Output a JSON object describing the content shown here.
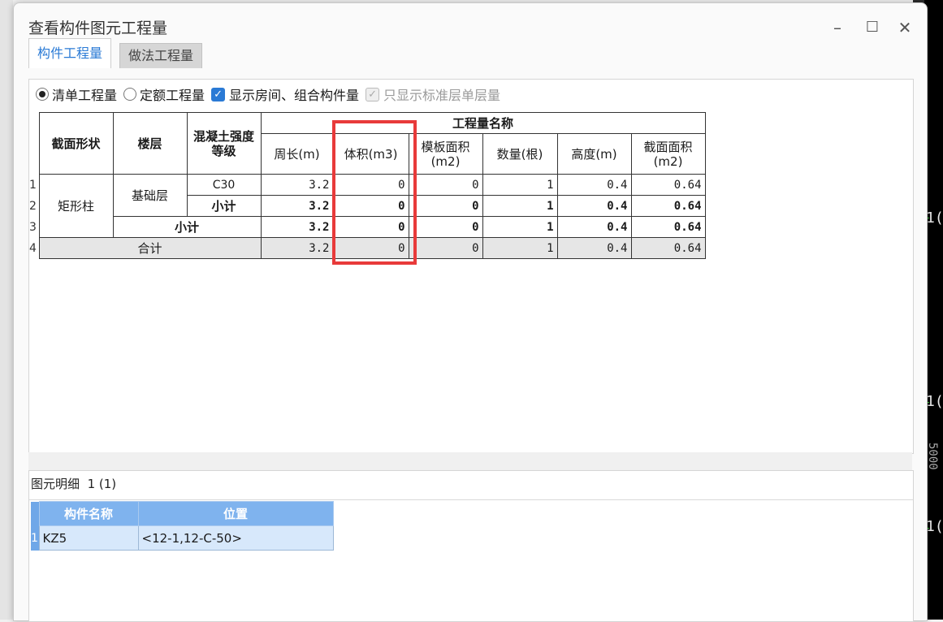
{
  "window": {
    "title": "查看构件图元工程量"
  },
  "tabs": [
    {
      "label": "构件工程量",
      "active": true
    },
    {
      "label": "做法工程量",
      "active": false
    }
  ],
  "options": {
    "radio_bill": "清单工程量",
    "radio_quota": "定额工程量",
    "check_show_room": "显示房间、组合构件量",
    "check_standard_floor": "只显示标准层单层量"
  },
  "table": {
    "headers": {
      "section_shape": "截面形状",
      "floor": "楼层",
      "concrete_grade": "混凝土强度等级",
      "quantity_name": "工程量名称",
      "perimeter": "周长(m)",
      "volume": "体积(m3)",
      "formwork_area": "模板面积(m2)",
      "count": "数量(根)",
      "height": "高度(m)",
      "section_area": "截面面积(m2)"
    },
    "rows": [
      {
        "num": "1",
        "shape": "矩形柱",
        "floor": "基础层",
        "grade": "C30",
        "perimeter": "3.2",
        "volume": "0",
        "formwork": "0",
        "count": "1",
        "height": "0.4",
        "area": "0.64"
      },
      {
        "num": "2",
        "subtotal_label": "小计",
        "perimeter": "3.2",
        "volume": "0",
        "formwork": "0",
        "count": "1",
        "height": "0.4",
        "area": "0.64"
      },
      {
        "num": "3",
        "subtotal_label": "小计",
        "perimeter": "3.2",
        "volume": "0",
        "formwork": "0",
        "count": "1",
        "height": "0.4",
        "area": "0.64"
      },
      {
        "num": "4",
        "total_label": "合计",
        "perimeter": "3.2",
        "volume": "0",
        "formwork": "0",
        "count": "1",
        "height": "0.4",
        "area": "0.64"
      }
    ]
  },
  "detail": {
    "label": "图元明细",
    "count": "1 (1)",
    "headers": {
      "name": "构件名称",
      "position": "位置"
    },
    "rows": [
      {
        "num": "1",
        "name": "KZ5",
        "position": "<12-1,12-C-50>"
      }
    ]
  },
  "background": {
    "marks": [
      "1(",
      "1(",
      "1("
    ],
    "vertical_text": "5000"
  },
  "colors": {
    "accent": "#2a7ad5",
    "highlight": "#e83a3a",
    "detail_header": "#7fb3ee"
  }
}
